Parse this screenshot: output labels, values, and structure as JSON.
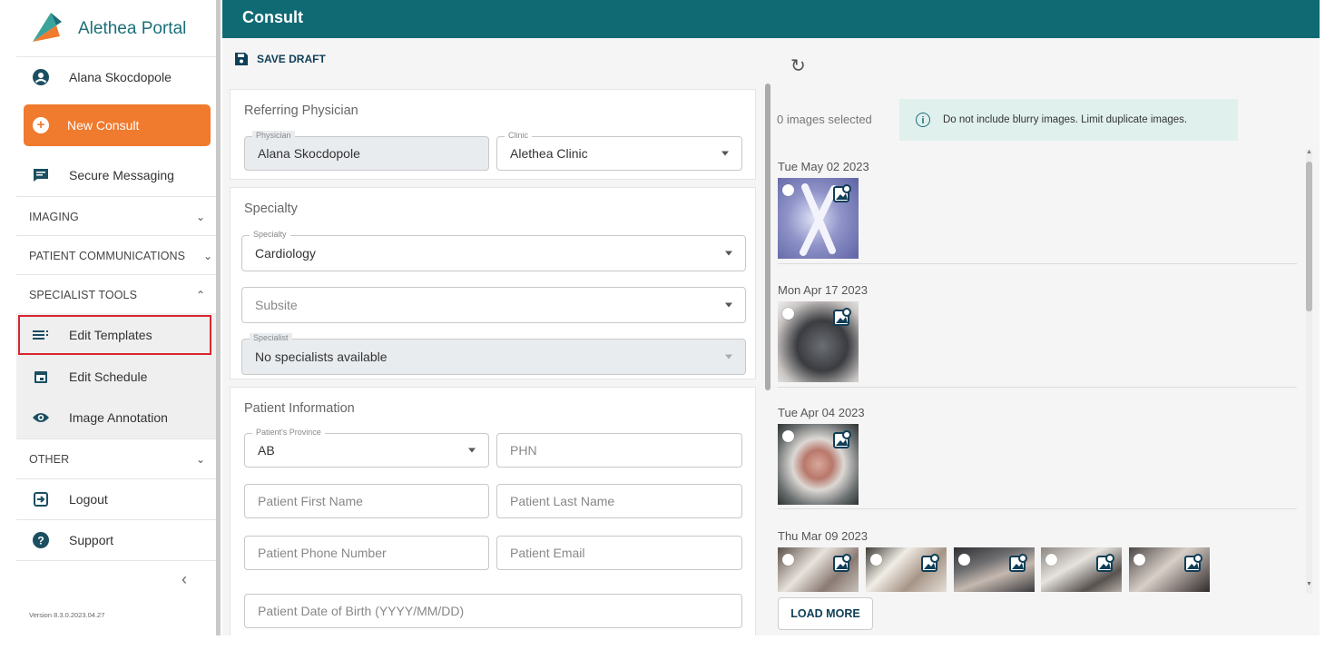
{
  "app": {
    "title": "Alethea Portal",
    "version": "Version 8.3.0.2023.04.27",
    "brand_color": "#0f6a73",
    "accent_color": "#f07a2e"
  },
  "sidebar": {
    "user_name": "Alana Skocdopole",
    "new_consult_label": "New Consult",
    "secure_messaging_label": "Secure Messaging",
    "sections": {
      "imaging": "IMAGING",
      "patient_communications": "PATIENT COMMUNICATIONS",
      "specialist_tools": "SPECIALIST TOOLS",
      "other": "OTHER"
    },
    "specialist_items": {
      "edit_templates": "Edit Templates",
      "edit_schedule": "Edit Schedule",
      "image_annotation": "Image Annotation"
    },
    "logout_label": "Logout",
    "support_label": "Support",
    "collapse_glyph": "‹",
    "icons": [
      "user-circle-icon",
      "plus-circle-icon",
      "message-icon",
      "list-icon",
      "calendar-icon",
      "eye-icon",
      "logout-icon",
      "help-icon"
    ]
  },
  "header": {
    "title": "Consult"
  },
  "toolbar": {
    "save_draft_label": "SAVE DRAFT"
  },
  "referring": {
    "title": "Referring Physician",
    "physician_label": "Physician",
    "physician_value": "Alana Skocdopole",
    "clinic_label": "Clinic",
    "clinic_value": "Alethea Clinic"
  },
  "specialty": {
    "title": "Specialty",
    "specialty_label": "Specialty",
    "specialty_value": "Cardiology",
    "subsite_placeholder": "Subsite",
    "specialist_label": "Specialist",
    "specialist_value": "No specialists available"
  },
  "patient": {
    "title": "Patient Information",
    "province_label": "Patient's Province",
    "province_value": "AB",
    "phn_placeholder": "PHN",
    "first_name_placeholder": "Patient First Name",
    "last_name_placeholder": "Patient Last Name",
    "phone_placeholder": "Patient Phone Number",
    "email_placeholder": "Patient Email",
    "dob_placeholder": "Patient Date of Birth (YYYY/MM/DD)"
  },
  "images": {
    "selected_count": "0 images selected",
    "alert": "Do not include blurry images. Limit duplicate images.",
    "groups": [
      {
        "date": "Tue May 02 2023",
        "count": 1
      },
      {
        "date": "Mon Apr 17 2023",
        "count": 1
      },
      {
        "date": "Tue Apr 04 2023",
        "count": 1
      },
      {
        "date": "Thu Mar 09 2023",
        "count": 5
      }
    ],
    "load_more_label": "LOAD MORE"
  }
}
